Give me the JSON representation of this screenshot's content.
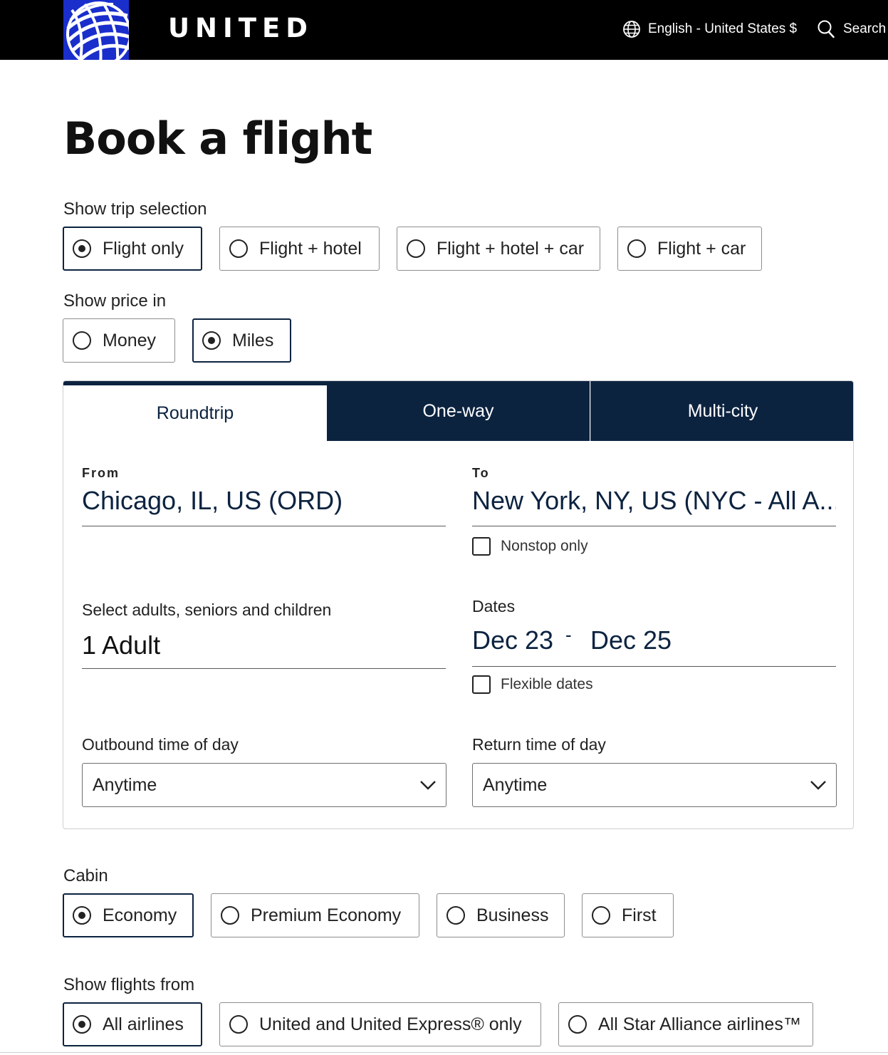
{
  "header": {
    "brand": "UNITED",
    "language": "English - United States $",
    "search": "Search"
  },
  "page_title": "Book a flight",
  "trip_selection": {
    "label": "Show trip selection",
    "options": [
      "Flight only",
      "Flight + hotel",
      "Flight + hotel + car",
      "Flight + car"
    ],
    "selected": "Flight only"
  },
  "price": {
    "label": "Show price in",
    "options": [
      "Money",
      "Miles"
    ],
    "selected": "Miles"
  },
  "tabs": [
    "Roundtrip",
    "One-way",
    "Multi-city"
  ],
  "active_tab": "Roundtrip",
  "form": {
    "from_label": "From",
    "from_value": "Chicago, IL, US (ORD)",
    "to_label": "To",
    "to_value": "New York, NY, US (NYC - All A...",
    "nonstop_label": "Nonstop only",
    "travelers_label": "Select adults, seniors and children",
    "travelers_value": "1 Adult",
    "dates_label": "Dates",
    "date_start": "Dec 23",
    "date_sep": "-",
    "date_end": "Dec 25",
    "flexible_label": "Flexible dates",
    "outbound_label": "Outbound time of day",
    "outbound_value": "Anytime",
    "return_label": "Return time of day",
    "return_value": "Anytime"
  },
  "cabin": {
    "label": "Cabin",
    "options": [
      "Economy",
      "Premium Economy",
      "Business",
      "First"
    ],
    "selected": "Economy"
  },
  "flights_from": {
    "label": "Show flights from",
    "options": [
      "All airlines",
      "United and United Express® only",
      "All Star Alliance airlines™"
    ],
    "selected": "All airlines"
  },
  "colors": {
    "brand_navy": "#0c2340",
    "logo_blue": "#1a2ecc",
    "header_bg": "#000000"
  },
  "icons": [
    "globe-icon",
    "search-icon",
    "chevron-down-icon"
  ]
}
